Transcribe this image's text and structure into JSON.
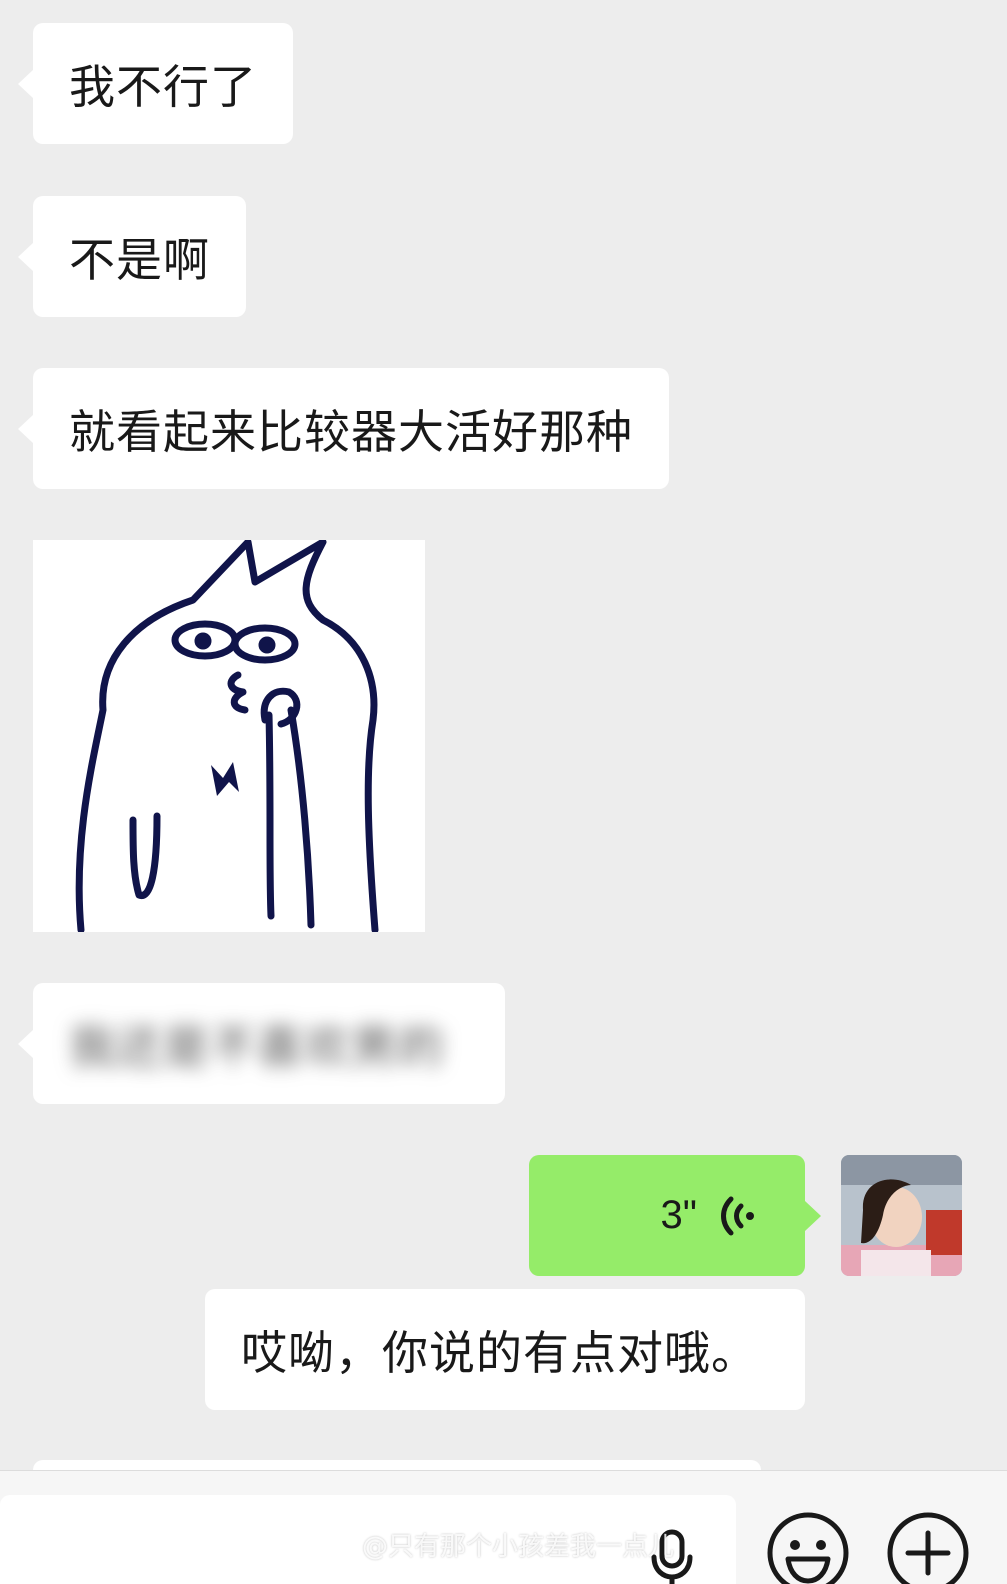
{
  "messages": {
    "m1": "我不行了",
    "m2": "不是啊",
    "m3": "就看起来比较器大活好那种",
    "m4_blurred": "我还是不喜欢男的",
    "voice_duration": "3\"",
    "transcript": "哎呦，你说的有点对哦。"
  },
  "watermark": {
    "text": "@只有那个小孩差我一点儿"
  },
  "colors": {
    "background": "#ededed",
    "incoming_bubble": "#ffffff",
    "outgoing_bubble": "#95ec69",
    "text": "#191919"
  },
  "icons": {
    "voice": "voice-wave-icon",
    "mic": "mic-icon",
    "emoji": "emoji-icon",
    "plus": "plus-icon",
    "weibo": "weibo-icon"
  }
}
